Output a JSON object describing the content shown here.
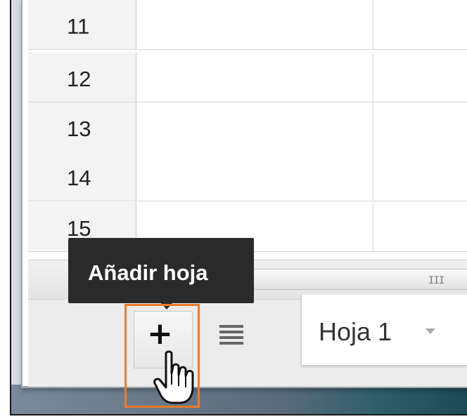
{
  "grid": {
    "row_numbers": [
      "11",
      "12",
      "13",
      "14",
      "15"
    ]
  },
  "scrollbar": {
    "grip": "III"
  },
  "sheet_bar": {
    "add_sheet_label": "+",
    "add_sheet_tooltip": "Añadir hoja",
    "sheet_list_icon": "list-icon",
    "tabs": [
      {
        "label": "Hoja 1"
      }
    ]
  },
  "colors": {
    "highlight": "#f07a2a",
    "tooltip_bg": "#2a2a2a"
  }
}
